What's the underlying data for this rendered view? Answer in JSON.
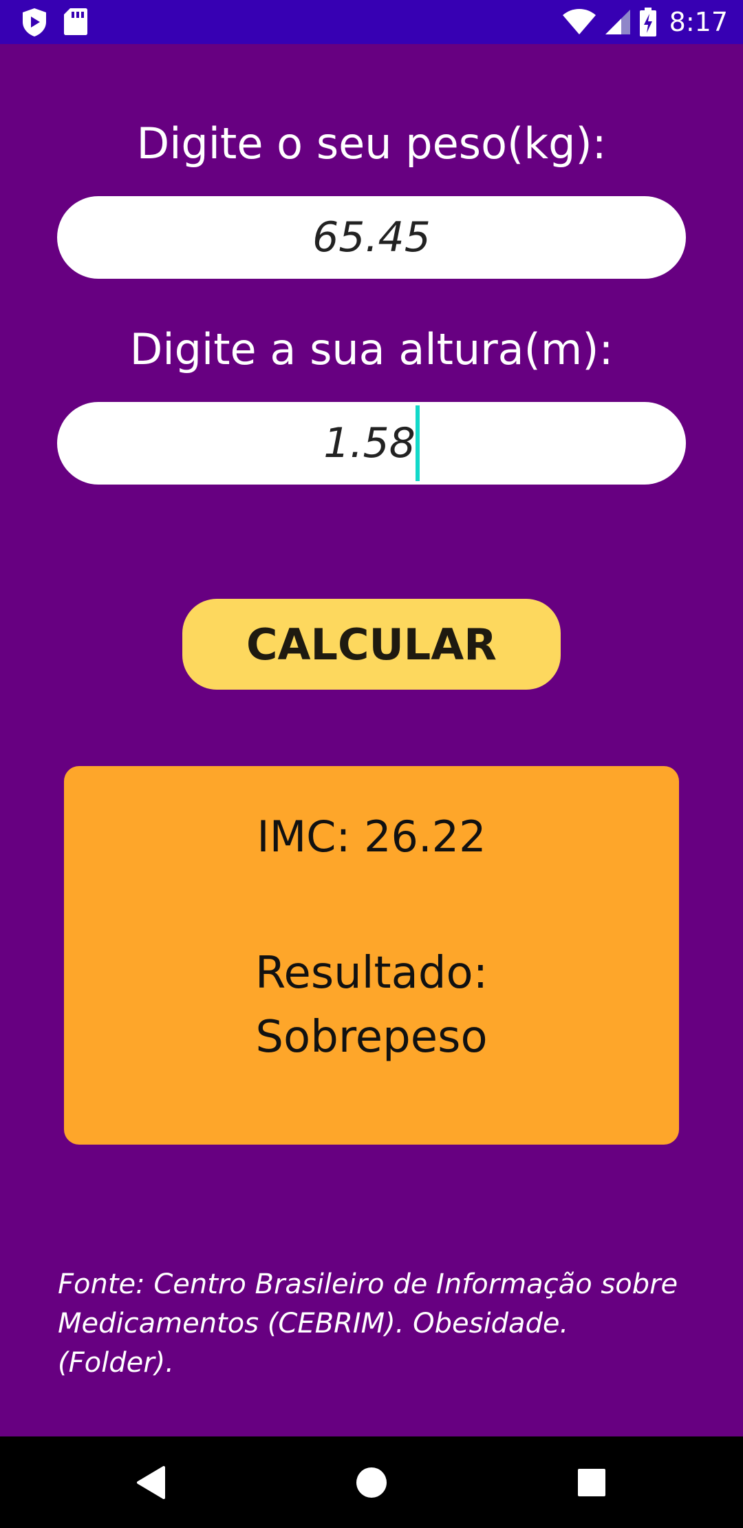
{
  "status_bar": {
    "time": "8:17",
    "icons": [
      "shield-play-icon",
      "sd-card-icon",
      "wifi-icon",
      "cell-signal-icon",
      "battery-charging-icon"
    ],
    "background": "#3700B3"
  },
  "form": {
    "weight_label": "Digite o seu peso(kg):",
    "weight_value": "65.45",
    "height_label": "Digite a sua altura(m):",
    "height_value": "1.58"
  },
  "calculate_button": {
    "label": "CALCULAR",
    "color": "#FDD85E"
  },
  "result": {
    "imc_text": "IMC: 26.22",
    "result_label": "Resultado:",
    "result_value": "Sobrepeso",
    "background": "#FEA62A"
  },
  "source_note": "Fonte: Centro Brasileiro de Informação sobre Medicamentos (CEBRIM). Obesidade. (Folder).",
  "navigation": {
    "icons": [
      "back-icon",
      "home-icon",
      "recent-apps-icon"
    ]
  },
  "theme": {
    "background": "#670081",
    "cursor_color": "#12d9c9"
  }
}
